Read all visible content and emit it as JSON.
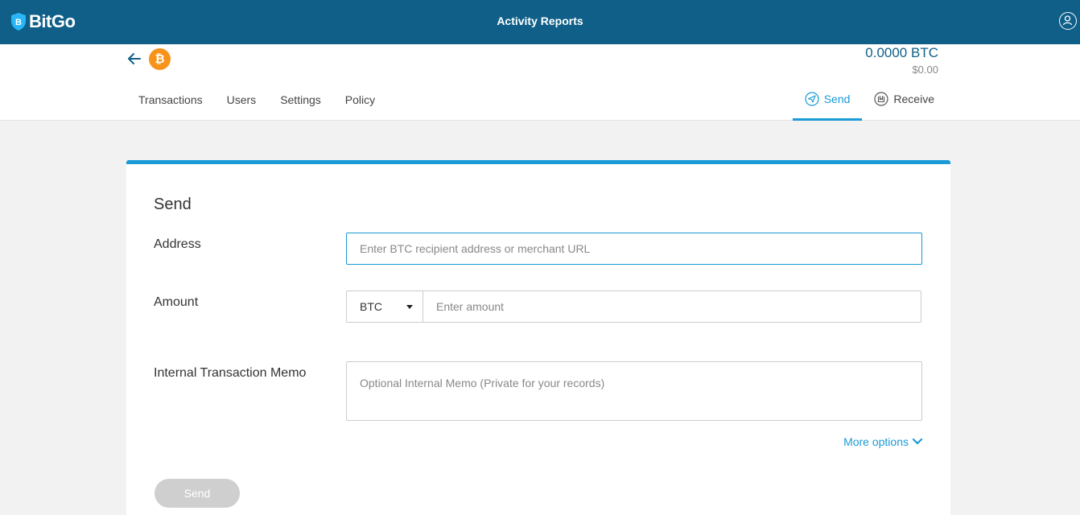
{
  "app": {
    "brand": "BitGo",
    "title": "Activity Reports"
  },
  "wallet": {
    "coin_symbol": "₿",
    "balance": "0.0000 BTC",
    "balance_usd": "$0.00"
  },
  "nav": {
    "items": [
      {
        "label": "Transactions"
      },
      {
        "label": "Users"
      },
      {
        "label": "Settings"
      },
      {
        "label": "Policy"
      }
    ],
    "actions": [
      {
        "label": "Send",
        "active": true,
        "icon": "send-icon"
      },
      {
        "label": "Receive",
        "active": false,
        "icon": "receive-icon"
      }
    ]
  },
  "form": {
    "title": "Send",
    "address": {
      "label": "Address",
      "placeholder": "Enter BTC recipient address or merchant URL"
    },
    "amount": {
      "label": "Amount",
      "currency": "BTC",
      "placeholder": "Enter amount"
    },
    "memo": {
      "label": "Internal Transaction Memo",
      "placeholder": "Optional Internal Memo (Private for your records)"
    },
    "more_options": "More options",
    "submit": "Send"
  },
  "colors": {
    "topbar": "#0f5f88",
    "accent": "#1a9ad6",
    "coin": "#f7931a",
    "disabled_button": "#cfcfcf"
  }
}
